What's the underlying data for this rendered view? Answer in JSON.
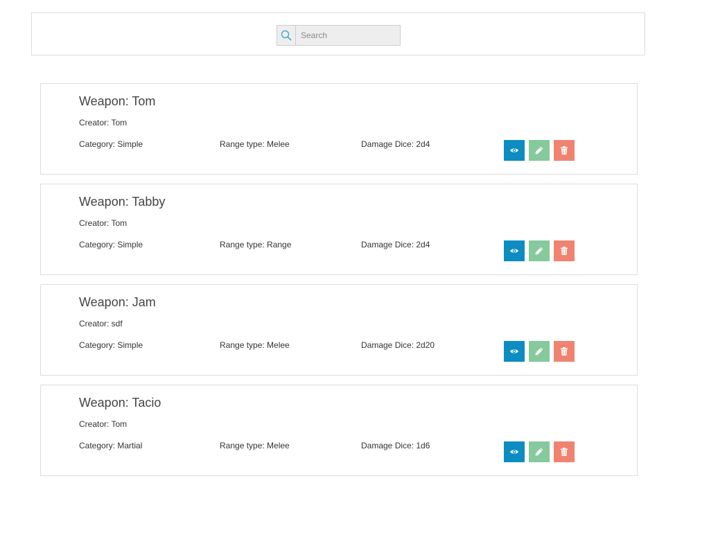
{
  "search": {
    "placeholder": "Search",
    "value": "",
    "icon": "search-icon"
  },
  "weapons": [
    {
      "title": "Weapon: Tom",
      "creator": "Creator: Tom",
      "category": "Category: Simple",
      "range_type": "Range type: Melee",
      "damage_dice": "Damage Dice: 2d4"
    },
    {
      "title": "Weapon: Tabby",
      "creator": "Creator: Tom",
      "category": "Category: Simple",
      "range_type": "Range type: Range",
      "damage_dice": "Damage Dice: 2d4"
    },
    {
      "title": "Weapon: Jam",
      "creator": "Creator: sdf",
      "category": "Category: Simple",
      "range_type": "Range type: Melee",
      "damage_dice": "Damage Dice: 2d20"
    },
    {
      "title": "Weapon: Tacio",
      "creator": "Creator: Tom",
      "category": "Category: Martial",
      "range_type": "Range type: Melee",
      "damage_dice": "Damage Dice: 1d6"
    }
  ],
  "actions": {
    "view_icon": "eye-icon",
    "edit_icon": "pencil-icon",
    "delete_icon": "trash-icon"
  },
  "colors": {
    "view": "#0d8cc1",
    "edit": "#85c99c",
    "delete": "#f0836f",
    "border": "#dcdcdc",
    "search_icon": "#4aa9d6"
  }
}
